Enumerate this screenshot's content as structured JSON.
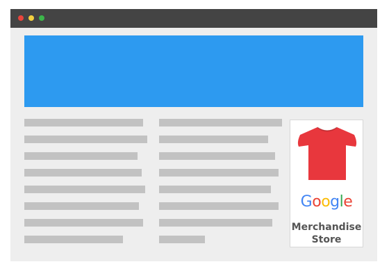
{
  "window": {
    "controls": [
      "close",
      "minimize",
      "maximize"
    ],
    "colors": {
      "titlebar": "#444444",
      "close": "#e8453c",
      "minimize": "#f4d03f",
      "maximize": "#3cb54a",
      "background": "#eeeeee"
    }
  },
  "banner": {
    "color": "#2d9af0"
  },
  "content": {
    "line_color": "#c2c2c2"
  },
  "ad": {
    "icon": "tshirt-icon",
    "tshirt_color": "#e8373d",
    "logo_letters": [
      "G",
      "o",
      "o",
      "g",
      "l",
      "e"
    ],
    "logo_colors": [
      "#4285f4",
      "#ea4335",
      "#fbbc05",
      "#4285f4",
      "#34a853",
      "#ea4335"
    ],
    "caption_line1": "Merchandise",
    "caption_line2": "Store"
  }
}
